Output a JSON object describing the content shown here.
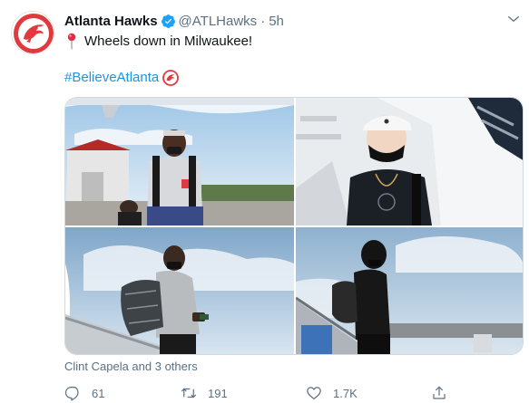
{
  "tweet": {
    "author": {
      "name": "Atlanta Hawks",
      "handle": "@ATLHawks",
      "separator": "·",
      "time": "5h",
      "verified": true
    },
    "text": "Wheels down in Milwaukee!",
    "text_icon": "round-pushpin-emoji",
    "hashtag": "#BelieveAtlanta",
    "hashtag_icon": "hawks-logo-emoji",
    "media": [
      {
        "name": "photo-player-headband"
      },
      {
        "name": "photo-player-white-cap"
      },
      {
        "name": "photo-player-backpack"
      },
      {
        "name": "photo-player-hoodie"
      }
    ],
    "tagged_people": "Clint Capela and 3 others",
    "actions": {
      "reply_count": "61",
      "retweet_count": "191",
      "like_count": "1.7K"
    },
    "colors": {
      "brand_red": "#e03a3e",
      "link_blue": "#1b95e0",
      "verified_blue": "#1da1f2",
      "muted_gray": "#5b7083"
    }
  }
}
